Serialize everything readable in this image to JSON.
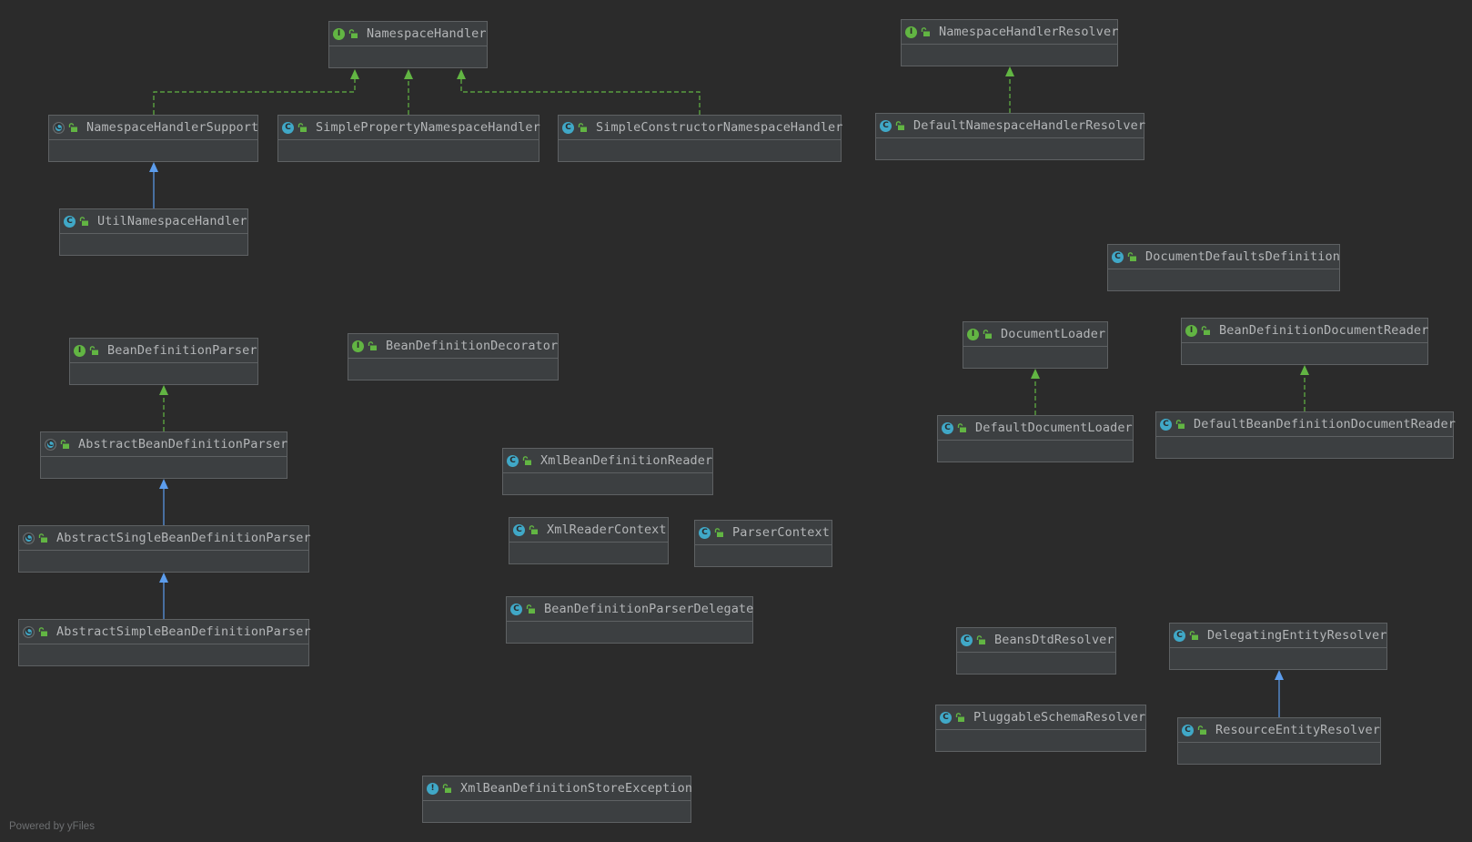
{
  "diagram": {
    "footer": "Powered by yFiles",
    "colors": {
      "background": "#2b2b2b",
      "node_fill": "#3c3f41",
      "node_border": "#5e6163",
      "implements_edge": "#62b543",
      "extends_edge": "#5c9ded",
      "interface_icon": "#62b543",
      "class_icon": "#40a8c7"
    },
    "nodes": [
      {
        "id": "NamespaceHandler",
        "label": "NamespaceHandler",
        "kind": "interface",
        "icon": "interface-icon"
      },
      {
        "id": "NamespaceHandlerResolver",
        "label": "NamespaceHandlerResolver",
        "kind": "interface",
        "icon": "interface-icon"
      },
      {
        "id": "NamespaceHandlerSupport",
        "label": "NamespaceHandlerSupport",
        "kind": "abstract",
        "icon": "abstract-class-icon"
      },
      {
        "id": "SimplePropertyNamespaceHandler",
        "label": "SimplePropertyNamespaceHandler",
        "kind": "class",
        "icon": "class-icon"
      },
      {
        "id": "SimpleConstructorNamespaceHandler",
        "label": "SimpleConstructorNamespaceHandler",
        "kind": "class",
        "icon": "class-icon"
      },
      {
        "id": "DefaultNamespaceHandlerResolver",
        "label": "DefaultNamespaceHandlerResolver",
        "kind": "class",
        "icon": "class-icon"
      },
      {
        "id": "UtilNamespaceHandler",
        "label": "UtilNamespaceHandler",
        "kind": "class",
        "icon": "class-icon"
      },
      {
        "id": "DocumentDefaultsDefinition",
        "label": "DocumentDefaultsDefinition",
        "kind": "class",
        "icon": "class-icon"
      },
      {
        "id": "BeanDefinitionParser",
        "label": "BeanDefinitionParser",
        "kind": "interface",
        "icon": "interface-icon"
      },
      {
        "id": "BeanDefinitionDecorator",
        "label": "BeanDefinitionDecorator",
        "kind": "interface",
        "icon": "interface-icon"
      },
      {
        "id": "DocumentLoader",
        "label": "DocumentLoader",
        "kind": "interface",
        "icon": "interface-icon"
      },
      {
        "id": "BeanDefinitionDocumentReader",
        "label": "BeanDefinitionDocumentReader",
        "kind": "interface",
        "icon": "interface-icon"
      },
      {
        "id": "AbstractBeanDefinitionParser",
        "label": "AbstractBeanDefinitionParser",
        "kind": "abstract",
        "icon": "abstract-class-icon"
      },
      {
        "id": "DefaultDocumentLoader",
        "label": "DefaultDocumentLoader",
        "kind": "class",
        "icon": "class-icon"
      },
      {
        "id": "DefaultBeanDefinitionDocumentReader",
        "label": "DefaultBeanDefinitionDocumentReader",
        "kind": "class",
        "icon": "class-icon"
      },
      {
        "id": "XmlBeanDefinitionReader",
        "label": "XmlBeanDefinitionReader",
        "kind": "class",
        "icon": "class-icon"
      },
      {
        "id": "AbstractSingleBeanDefinitionParser",
        "label": "AbstractSingleBeanDefinitionParser",
        "kind": "abstract",
        "icon": "abstract-class-icon"
      },
      {
        "id": "XmlReaderContext",
        "label": "XmlReaderContext",
        "kind": "class",
        "icon": "class-icon"
      },
      {
        "id": "ParserContext",
        "label": "ParserContext",
        "kind": "class",
        "icon": "class-icon"
      },
      {
        "id": "BeanDefinitionParserDelegate",
        "label": "BeanDefinitionParserDelegate",
        "kind": "class",
        "icon": "class-icon"
      },
      {
        "id": "AbstractSimpleBeanDefinitionParser",
        "label": "AbstractSimpleBeanDefinitionParser",
        "kind": "abstract",
        "icon": "abstract-class-icon"
      },
      {
        "id": "BeansDtdResolver",
        "label": "BeansDtdResolver",
        "kind": "class",
        "icon": "class-icon"
      },
      {
        "id": "DelegatingEntityResolver",
        "label": "DelegatingEntityResolver",
        "kind": "class",
        "icon": "class-icon"
      },
      {
        "id": "PluggableSchemaResolver",
        "label": "PluggableSchemaResolver",
        "kind": "class",
        "icon": "class-icon"
      },
      {
        "id": "ResourceEntityResolver",
        "label": "ResourceEntityResolver",
        "kind": "class",
        "icon": "class-icon"
      },
      {
        "id": "XmlBeanDefinitionStoreException",
        "label": "XmlBeanDefinitionStoreException",
        "kind": "exception",
        "icon": "exception-class-icon"
      }
    ],
    "edges": [
      {
        "from": "NamespaceHandlerSupport",
        "to": "NamespaceHandler",
        "type": "implements"
      },
      {
        "from": "SimplePropertyNamespaceHandler",
        "to": "NamespaceHandler",
        "type": "implements"
      },
      {
        "from": "SimpleConstructorNamespaceHandler",
        "to": "NamespaceHandler",
        "type": "implements"
      },
      {
        "from": "DefaultNamespaceHandlerResolver",
        "to": "NamespaceHandlerResolver",
        "type": "implements"
      },
      {
        "from": "UtilNamespaceHandler",
        "to": "NamespaceHandlerSupport",
        "type": "extends"
      },
      {
        "from": "AbstractBeanDefinitionParser",
        "to": "BeanDefinitionParser",
        "type": "implements"
      },
      {
        "from": "AbstractSingleBeanDefinitionParser",
        "to": "AbstractBeanDefinitionParser",
        "type": "extends"
      },
      {
        "from": "AbstractSimpleBeanDefinitionParser",
        "to": "AbstractSingleBeanDefinitionParser",
        "type": "extends"
      },
      {
        "from": "DefaultDocumentLoader",
        "to": "DocumentLoader",
        "type": "implements"
      },
      {
        "from": "DefaultBeanDefinitionDocumentReader",
        "to": "BeanDefinitionDocumentReader",
        "type": "implements"
      },
      {
        "from": "ResourceEntityResolver",
        "to": "DelegatingEntityResolver",
        "type": "extends"
      }
    ]
  }
}
